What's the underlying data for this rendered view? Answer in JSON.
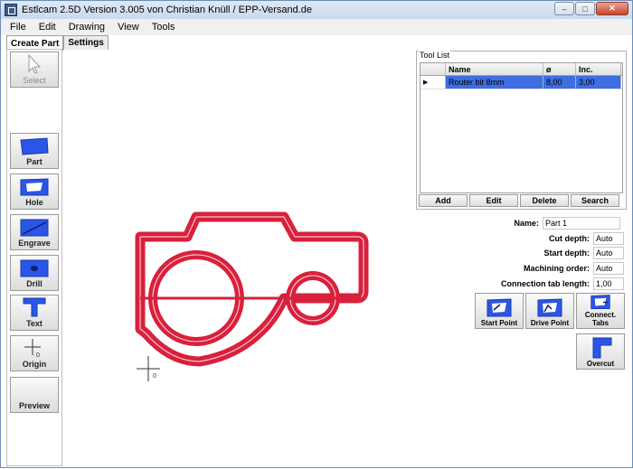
{
  "window": {
    "title": "Estlcam 2.5D Version 3.005 von Christian Knüll / EPP-Versand.de",
    "controls": {
      "minimize": "–",
      "maximize": "□",
      "close": "✕"
    }
  },
  "menu": [
    "File",
    "Edit",
    "Drawing",
    "View",
    "Tools"
  ],
  "tabs": [
    "Create Part",
    "Settings"
  ],
  "left_tools": [
    {
      "label": "Select",
      "icon": "cursor-arrow-icon",
      "enabled": false
    },
    {
      "label": "Part",
      "icon": "part-icon"
    },
    {
      "label": "Hole",
      "icon": "hole-icon"
    },
    {
      "label": "Engrave",
      "icon": "engrave-icon"
    },
    {
      "label": "Drill",
      "icon": "drill-icon"
    },
    {
      "label": "Text",
      "icon": "text-tool-icon"
    },
    {
      "label": "Origin",
      "icon": "origin-icon"
    },
    {
      "label": "Preview",
      "icon": "preview-icon"
    }
  ],
  "tool_list": {
    "title": "Tool List",
    "columns": [
      "Name",
      "ø",
      "Inc."
    ],
    "rows": [
      {
        "name": "Router bit 8mm",
        "diameter": "8,00",
        "inc": "3,00"
      }
    ],
    "buttons": [
      "Add",
      "Edit",
      "Delete",
      "Search"
    ]
  },
  "properties": {
    "name_label": "Name:",
    "name_value": "Part 1",
    "cut_depth_label": "Cut depth:",
    "cut_depth_value": "Auto",
    "start_depth_label": "Start depth:",
    "start_depth_value": "Auto",
    "machining_order_label": "Machining order:",
    "machining_order_value": "Auto",
    "connection_tab_length_label": "Connection tab length:",
    "connection_tab_length_value": "1,00"
  },
  "right_buttons": [
    "Start Point",
    "Drive Point",
    "Connect. Tabs",
    "Overcut"
  ],
  "canvas": {
    "origin_label": "0",
    "colors": {
      "toolpath": "#d9203c",
      "icon_blue": "#2b55e6"
    }
  }
}
